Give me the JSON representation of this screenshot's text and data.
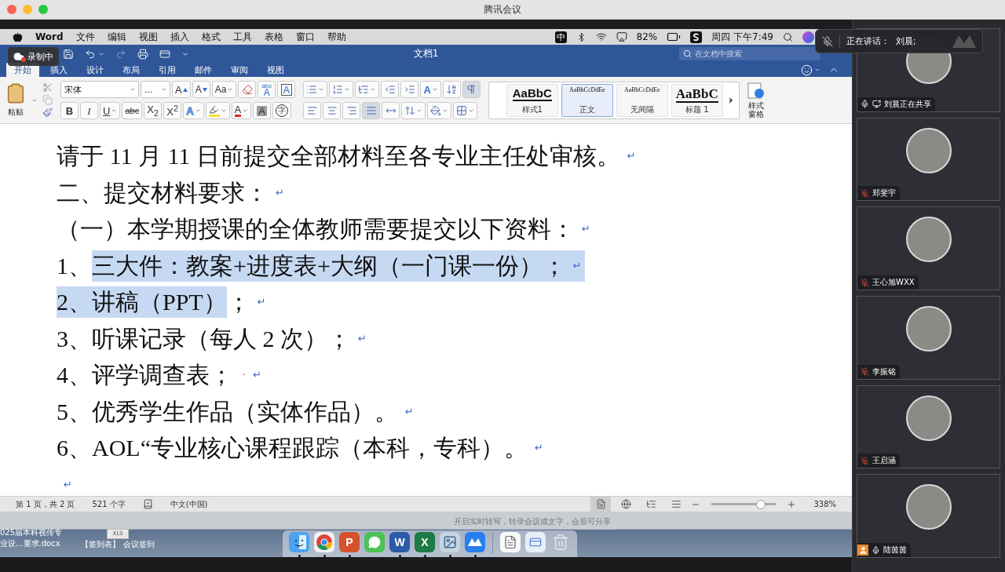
{
  "window": {
    "title": "腾讯会议"
  },
  "menu_bar": {
    "app": "Word",
    "items": [
      "文件",
      "编辑",
      "视图",
      "插入",
      "格式",
      "工具",
      "表格",
      "窗口",
      "帮助"
    ],
    "input_method": "中",
    "battery": "82%",
    "clock": "周四 下午7:49"
  },
  "recording": {
    "label": "录制中"
  },
  "word": {
    "title": "文档1",
    "search": {
      "placeholder": "在文档中搜索"
    },
    "tabs": [
      {
        "label": "开始",
        "selected": true
      },
      {
        "label": "插入",
        "selected": false
      },
      {
        "label": "设计",
        "selected": false
      },
      {
        "label": "布局",
        "selected": false
      },
      {
        "label": "引用",
        "selected": false
      },
      {
        "label": "邮件",
        "selected": false
      },
      {
        "label": "审阅",
        "selected": false
      },
      {
        "label": "视图",
        "selected": false
      }
    ],
    "ribbon": {
      "paste": "粘贴",
      "font": "宋体",
      "font_size": "...",
      "font_row_1": [
        {
          "kind": "grow",
          "label": "A",
          "menu": false
        },
        {
          "kind": "shrink",
          "label": "A",
          "menu": false
        },
        {
          "kind": "case",
          "label": "Aa",
          "menu": true
        },
        {
          "kind": "clear",
          "menu": false
        },
        {
          "kind": "phonetic",
          "note": "abc",
          "label": "A",
          "menu": false
        },
        {
          "kind": "boxed",
          "label": "A",
          "menu": false
        }
      ],
      "font_row_2": [
        {
          "kind": "bold",
          "label": "B",
          "menu": false
        },
        {
          "kind": "italic",
          "label": "I",
          "menu": false
        },
        {
          "kind": "underline",
          "label": "U",
          "menu": true
        },
        {
          "kind": "strike",
          "label": "abc",
          "menu": false
        },
        {
          "kind": "sub",
          "label": "X$_{2}$",
          "menu": false
        },
        {
          "kind": "sup",
          "label": "X$^{2}$",
          "menu": false
        },
        {
          "kind": "effects",
          "label": "A",
          "menu": true
        },
        {
          "kind": "highlight",
          "menu": true
        },
        {
          "kind": "color",
          "label": "A",
          "menu": true
        },
        {
          "kind": "shade",
          "label": "A",
          "menu": false
        },
        {
          "kind": "enclose",
          "label": "字",
          "menu": false
        }
      ],
      "para_row_1": [
        {
          "kind": "bullets",
          "menu": true,
          "selected": false
        },
        {
          "kind": "numbering",
          "menu": true,
          "selected": false
        },
        {
          "kind": "multilevel",
          "menu": true,
          "selected": false
        },
        {
          "kind": "outdent",
          "menu": false,
          "selected": false
        },
        {
          "kind": "indent",
          "menu": false,
          "selected": false
        },
        {
          "kind": "asian",
          "label": "A",
          "menu": true,
          "selected": false
        },
        {
          "kind": "sort",
          "menu": false,
          "selected": false
        },
        {
          "kind": "marks",
          "menu": false,
          "selected": true
        }
      ],
      "para_row_2": [
        {
          "kind": "left",
          "menu": false,
          "selected": false
        },
        {
          "kind": "center",
          "menu": false,
          "selected": false
        },
        {
          "kind": "right",
          "menu": false,
          "selected": false
        },
        {
          "kind": "justify",
          "menu": false,
          "selected": true
        },
        {
          "kind": "distribute",
          "menu": false,
          "selected": false
        },
        {
          "kind": "spacing",
          "menu": true,
          "selected": false
        },
        {
          "kind": "fill",
          "menu": true,
          "selected": false
        },
        {
          "kind": "borders",
          "menu": true,
          "selected": false
        }
      ],
      "styles": [
        {
          "kind": "heavy",
          "preview": "AaBbC",
          "label": "样式1",
          "selected": false
        },
        {
          "kind": "plain",
          "preview": "AaBbCcDdEe",
          "label": "正文",
          "selected": true
        },
        {
          "kind": "plain",
          "preview": "AaBbCcDdEe",
          "label": "无间隔",
          "selected": false
        },
        {
          "kind": "heading",
          "preview": "AaBbC",
          "label": "标题 1",
          "selected": false
        }
      ],
      "styles_pane": "样式窗格"
    },
    "document": {
      "lines": [
        {
          "segments": [
            {
              "text": "请于 11 月 11 日前提交全部材料至各专业主任处审核。",
              "selected": false
            }
          ],
          "mark": "↵",
          "mark_selected": false
        },
        {
          "segments": [
            {
              "text": "二、提交材料要求：",
              "selected": false
            }
          ],
          "mark": "↵",
          "mark_selected": false
        },
        {
          "segments": [
            {
              "text": "（一）本学期授课的全体教师需要提交以下资料：",
              "selected": false
            }
          ],
          "mark": "↵",
          "mark_selected": false
        },
        {
          "segments": [
            {
              "text": "1、",
              "selected": false
            },
            {
              "text": "三大件：教案+进度表+大纲（一门课一份）；",
              "selected": true
            }
          ],
          "mark": "↵",
          "mark_selected": true
        },
        {
          "segments": [
            {
              "text": "2、讲稿（PPT）",
              "selected": true
            },
            {
              "text": "；",
              "selected": false
            }
          ],
          "mark": "↵",
          "mark_selected": false
        },
        {
          "segments": [
            {
              "text": "3、听课记录（每人 2 次）；",
              "selected": false
            }
          ],
          "mark": "↵",
          "mark_selected": false
        },
        {
          "segments": [
            {
              "text": "4、评学调查表；",
              "selected": false
            }
          ],
          "space_mark": "·",
          "mark": "↵",
          "mark_selected": false
        },
        {
          "segments": [
            {
              "text": "5、优秀学生作品（实体作品）。",
              "selected": false
            }
          ],
          "mark": "↵",
          "mark_selected": false
        },
        {
          "segments": [
            {
              "text": "6、AOL“专业核心课程跟踪（本科，专科）。",
              "selected": false
            }
          ],
          "mark": "↵",
          "mark_selected": false
        },
        {
          "mark": "↵",
          "mark_selected": false
        }
      ]
    },
    "status_bar": {
      "page": "第 1 页，共 2 页",
      "words": "521 个字",
      "language": "中文(中国)",
      "views": [
        {
          "kind": "print",
          "selected": true
        },
        {
          "kind": "web",
          "selected": false
        },
        {
          "kind": "outline",
          "selected": false
        },
        {
          "kind": "draft",
          "selected": false
        }
      ],
      "zoom": {
        "level": 0.76,
        "reading": "338%"
      }
    }
  },
  "desktop": {
    "files": [
      {
        "kind": "docx",
        "lines": [
          "025届本科视传专",
          "业设...要求.docx"
        ]
      },
      {
        "kind": "xls",
        "thumb": "XLS",
        "lines": [
          "【签到表】 会议签到"
        ]
      }
    ],
    "transcribe_tip": "开启实时转写，转录会议成文字，会后可分享"
  },
  "dock": {
    "apps": [
      {
        "kind": "finder",
        "running": true
      },
      {
        "kind": "browser",
        "running": true
      },
      {
        "kind": "slides",
        "glyph": "P",
        "running": true
      },
      {
        "kind": "chat",
        "running": false
      },
      {
        "kind": "docs",
        "glyph": "W",
        "running": true
      },
      {
        "kind": "sheets",
        "glyph": "X",
        "running": true
      },
      {
        "kind": "photos",
        "running": true
      },
      {
        "kind": "meeting",
        "running": true
      }
    ],
    "extras": [
      {
        "kind": "document"
      },
      {
        "kind": "screenshot"
      },
      {
        "kind": "trash"
      }
    ]
  },
  "speaker": {
    "label": "正在讲话：",
    "name": "刘晨;"
  },
  "participants": [
    {
      "name": "刘晨正在共享",
      "muted": false,
      "sharing": true,
      "host": false
    },
    {
      "name": "郑斐宇",
      "muted": true,
      "sharing": false,
      "host": false
    },
    {
      "name": "王心旭WXX",
      "muted": true,
      "sharing": false,
      "host": false
    },
    {
      "name": "李振铭",
      "muted": true,
      "sharing": false,
      "host": false
    },
    {
      "name": "王启涵",
      "muted": true,
      "sharing": false,
      "host": false
    },
    {
      "name": "陆茵茵",
      "muted": false,
      "sharing": false,
      "host": true
    }
  ]
}
